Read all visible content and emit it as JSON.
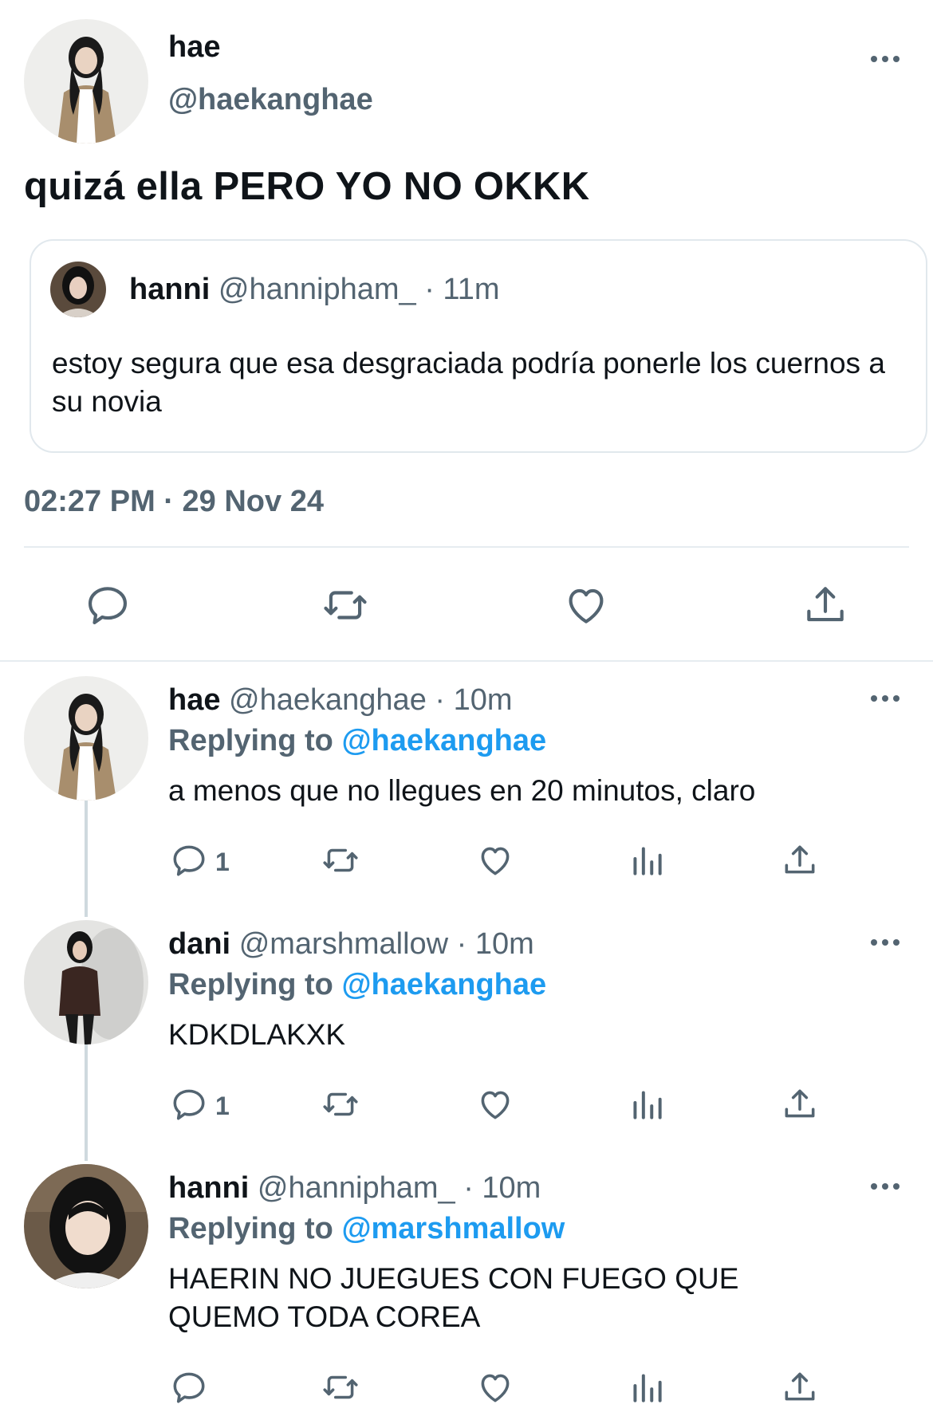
{
  "main_tweet": {
    "name": "hae",
    "handle": "@haekanghae",
    "text": "quizá ella PERO YO NO OKKK",
    "timestamp": "02:27 PM · 29 Nov 24",
    "more_icon": "ellipsis-icon",
    "quoted": {
      "name": "hanni",
      "handle": "@hannipham_",
      "time": "· 11m",
      "text": "estoy segura que esa desgraciada podría ponerle los cuernos a su novia"
    },
    "actions": [
      "reply-icon",
      "retweet-icon",
      "like-icon",
      "share-icon"
    ]
  },
  "replies": [
    {
      "name": "hae",
      "handle": "@haekanghae",
      "time": "· 10m",
      "replying_label": "Replying to",
      "replying_to": "@haekanghae",
      "text": "a menos que no llegues en 20 minutos, claro",
      "reply_count": "1"
    },
    {
      "name": "dani",
      "handle": "@marshmallow",
      "time": "· 10m",
      "replying_label": "Replying to",
      "replying_to": "@haekanghae",
      "text": "KDKDLAKXK",
      "reply_count": "1"
    },
    {
      "name": "hanni",
      "handle": "@hannipham_",
      "time": "· 10m",
      "replying_label": "Replying to",
      "replying_to": "@marshmallow",
      "text": "HAERIN NO JUEGUES CON FUEGO QUE QUEMO TODA COREA",
      "reply_count": ""
    }
  ],
  "colors": {
    "text": "#0f1419",
    "secondary": "#536471",
    "link": "#1d9bf0",
    "border": "#e1e8ed"
  }
}
